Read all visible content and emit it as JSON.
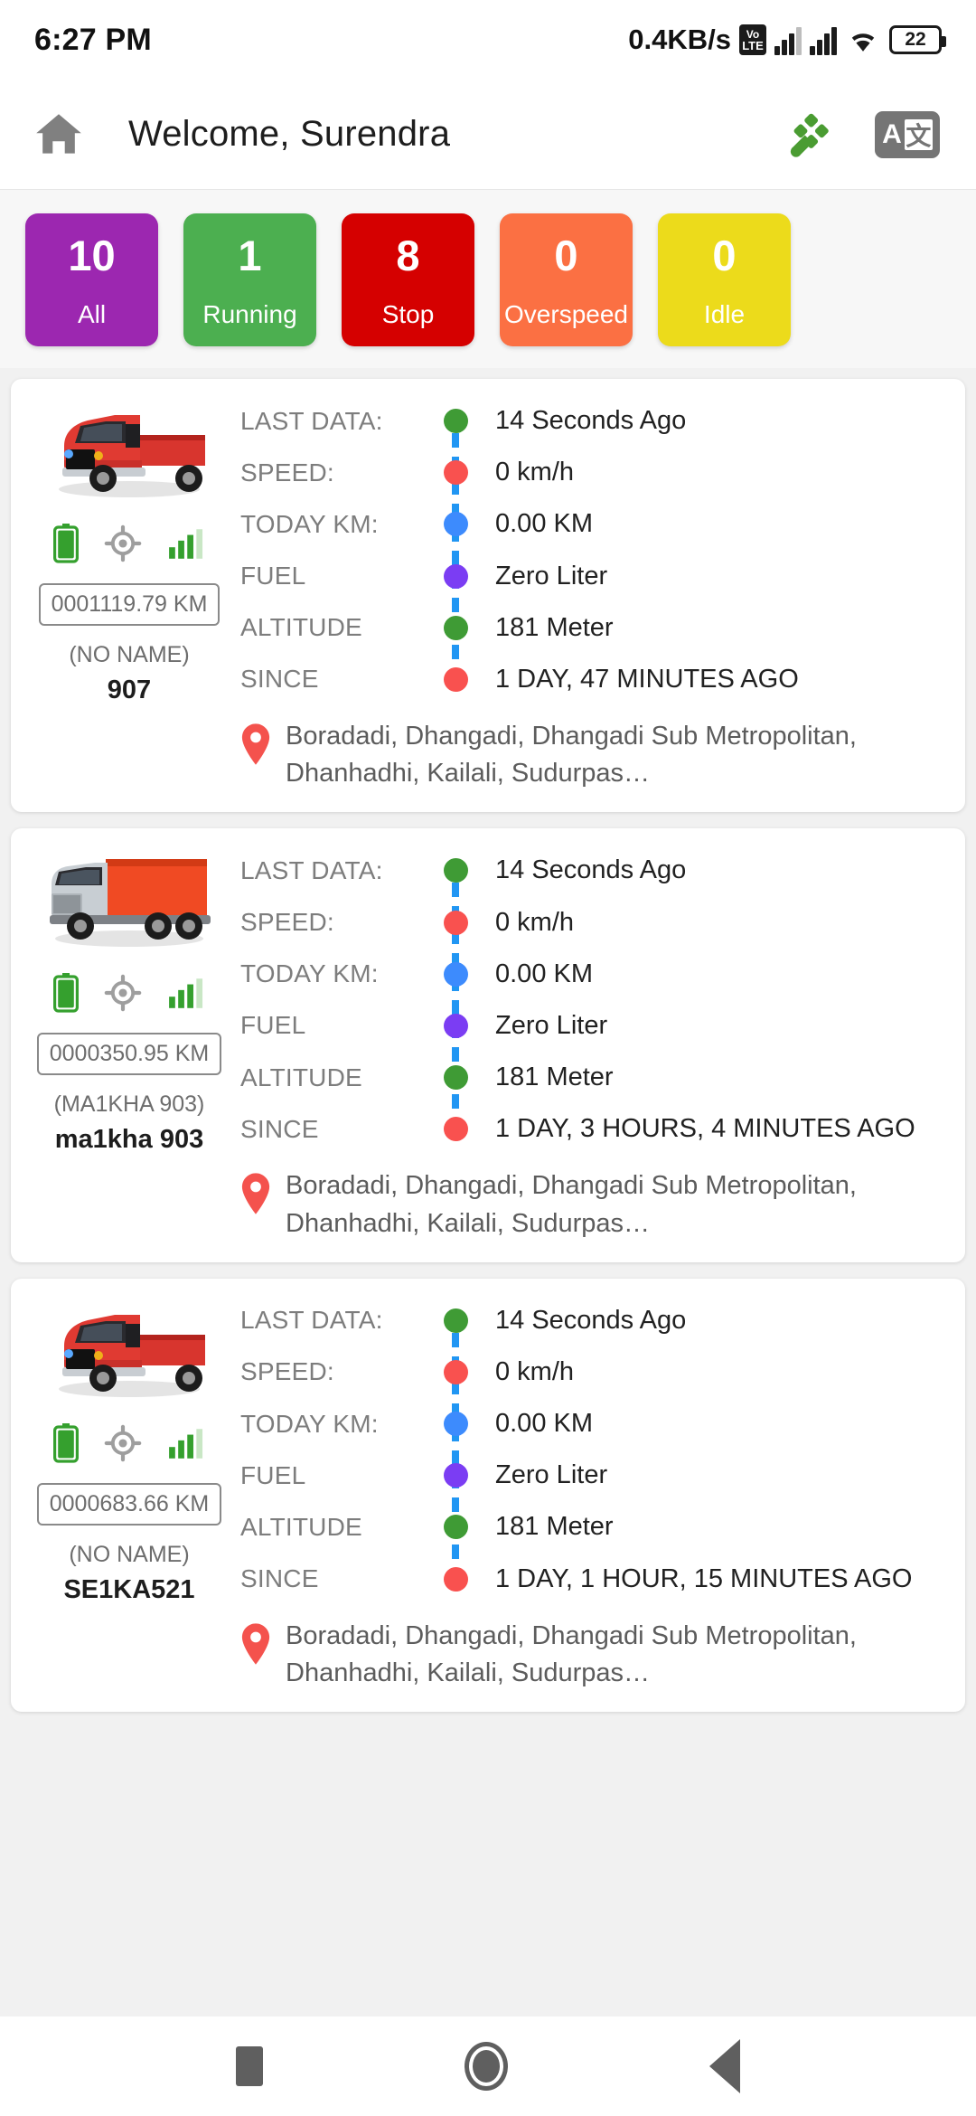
{
  "status_bar": {
    "time": "6:27 PM",
    "network_speed": "0.4KB/s",
    "volte_top": "Vo",
    "volte_bottom": "LTE",
    "battery_percent": "22"
  },
  "app_bar": {
    "title": "Welcome, Surendra",
    "home_icon": "home-icon",
    "satellite_icon": "satellite-icon",
    "translate_icon": "translate-icon",
    "translate_letter": "A",
    "translate_glyph": "文"
  },
  "status_tiles": [
    {
      "count": "10",
      "label": "All",
      "color": "#9c27b0"
    },
    {
      "count": "1",
      "label": "Running",
      "color": "#4caf50"
    },
    {
      "count": "8",
      "label": "Stop",
      "color": "#d50000"
    },
    {
      "count": "0",
      "label": "Overspeed",
      "color": "#fb7043"
    },
    {
      "count": "0",
      "label": "Idle",
      "color": "#ecdb1b"
    }
  ],
  "row_labels": [
    "LAST DATA:",
    "SPEED:",
    "TODAY KM:",
    "FUEL",
    "ALTITUDE",
    "SINCE"
  ],
  "dot_colors": [
    "#3f9b35",
    "#f9514f",
    "#3d8bfd",
    "#7b3df3",
    "#3f9b35",
    "#f9514f"
  ],
  "vehicles": [
    {
      "vehicle_type": "pickup-truck-red",
      "odometer": "0001119.79 KM",
      "alias": "(NO NAME)",
      "name": "907",
      "values": [
        "14 Seconds Ago",
        "0 km/h",
        "0.00 KM",
        "Zero Liter",
        "181 Meter",
        "1 DAY, 47 MINUTES AGO"
      ],
      "address": "Boradadi, Dhangadi, Dhangadi Sub Metropolitan, Dhanhadhi, Kailali, Sudurpas…"
    },
    {
      "vehicle_type": "box-truck-red",
      "odometer": "0000350.95 KM",
      "alias": "(MA1KHA 903)",
      "name": "ma1kha 903",
      "values": [
        "14 Seconds Ago",
        "0 km/h",
        "0.00 KM",
        "Zero Liter",
        "181 Meter",
        "1 DAY, 3 HOURS, 4 MINUTES AGO"
      ],
      "address": "Boradadi, Dhangadi, Dhangadi Sub Metropolitan, Dhanhadhi, Kailali, Sudurpas…"
    },
    {
      "vehicle_type": "pickup-truck-red",
      "odometer": "0000683.66 KM",
      "alias": "(NO NAME)",
      "name": "SE1KA521",
      "values": [
        "14 Seconds Ago",
        "0 km/h",
        "0.00 KM",
        "Zero Liter",
        "181 Meter",
        "1 DAY, 1 HOUR, 15 MINUTES AGO"
      ],
      "address": "Boradadi, Dhangadi, Dhangadi Sub Metropolitan, Dhanhadhi, Kailali, Sudurpas…"
    }
  ],
  "nav_bar": {
    "recents": "recents-square-icon",
    "home": "home-circle-icon",
    "back": "back-triangle-icon"
  }
}
